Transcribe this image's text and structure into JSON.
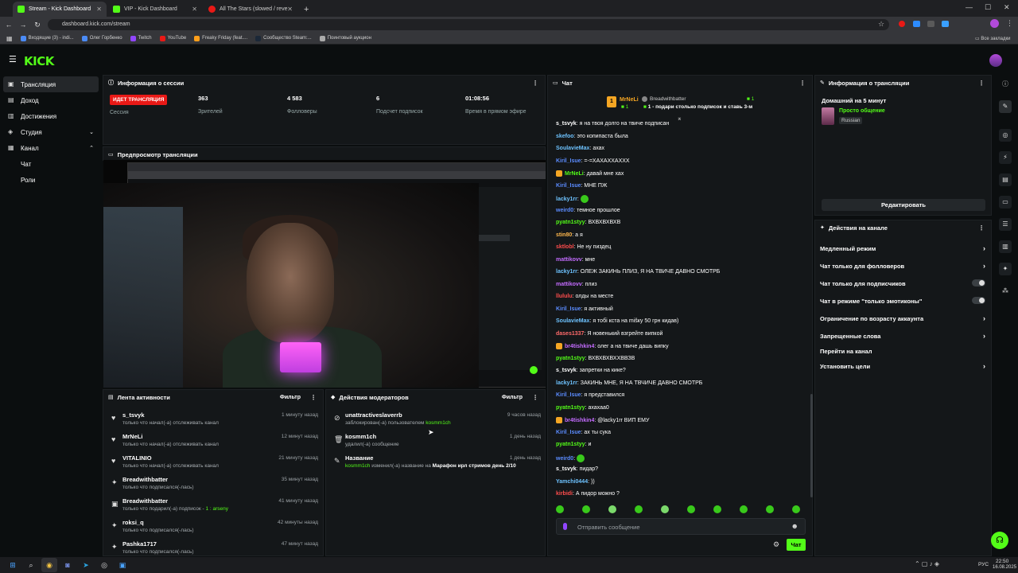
{
  "browser": {
    "tabs": [
      {
        "title": "Stream - Kick Dashboard",
        "active": true,
        "color": "#53fc18"
      },
      {
        "title": "VIP - Kick Dashboard",
        "active": false,
        "color": "#53fc18"
      },
      {
        "title": "All The Stars (slowed / reve",
        "active": false,
        "color": "#e91916"
      }
    ],
    "url": "dashboard.kick.com/stream",
    "bookmarks": [
      "Входящие (3) - indi...",
      "Олег Горбенко",
      "Twitch",
      "YouTube",
      "Freaky Friday (feat....",
      "Сообщество Steam:...",
      "Поинтовый аукцион"
    ],
    "all_bookmarks": "Все закладки"
  },
  "kick": {
    "logo": "KICK",
    "sidebar": [
      {
        "label": "Трансляция",
        "icon": "broadcast-icon",
        "active": true
      },
      {
        "label": "Доход",
        "icon": "wallet-icon"
      },
      {
        "label": "Достижения",
        "icon": "trophy-icon"
      },
      {
        "label": "Студия",
        "icon": "studio-icon",
        "chevron": "down"
      },
      {
        "label": "Канал",
        "icon": "channel-icon",
        "chevron": "up"
      }
    ],
    "sidebar_sub": [
      "Чат",
      "Роли"
    ]
  },
  "session": {
    "title": "Информация о сессии",
    "live_badge": "ИДЕТ ТРАНСЛЯЦИЯ",
    "session_label": "Сессия",
    "stats": [
      {
        "value": "363",
        "label": "Зрителей"
      },
      {
        "value": "4 583",
        "label": "Фолловеры"
      },
      {
        "value": "6",
        "label": "Подсчет подписок"
      },
      {
        "value": "01:08:56",
        "label": "Время в прямом эфире"
      }
    ]
  },
  "preview": {
    "title": "Предпросмотр трансляции"
  },
  "activity": {
    "title": "Лента активности",
    "filter": "Фильтр",
    "items": [
      {
        "name": "s_tsvyk",
        "desc": "только что начал(-а) отслеживать канал",
        "time": "1 минуту назад",
        "icon": "heart-icon"
      },
      {
        "name": "MrNeLi",
        "desc": "только что начал(-а) отслеживать канал",
        "time": "12 минут назад",
        "icon": "heart-icon"
      },
      {
        "name": "VITALINIO",
        "desc": "только что начал(-а) отслеживать канал",
        "time": "21 минуту назад",
        "icon": "heart-icon"
      },
      {
        "name": "Breadwithbatter",
        "desc": "только что подписался(-лась)",
        "time": "35 минут назад",
        "icon": "star-icon"
      },
      {
        "name": "Breadwithbatter",
        "desc": "только что подарил(-а) подписок - ",
        "desc_extra": "1 : arseny",
        "time": "41 минуту назад",
        "icon": "gift-icon"
      },
      {
        "name": "roksi_q",
        "desc": "только что подписался(-лась)",
        "time": "42 минуты назад",
        "icon": "star-icon"
      },
      {
        "name": "Pashka1717",
        "desc": "только что подписался(-лась)",
        "time": "47 минут назад",
        "icon": "star-icon"
      }
    ]
  },
  "moderators": {
    "title": "Действия модераторов",
    "filter": "Фильтр",
    "items": [
      {
        "name": "unattractiveslaverrb",
        "desc": "заблокирован(-а) пользователем ",
        "who": "kosmm1ch",
        "time": "9 часов назад",
        "icon": "ban-icon"
      },
      {
        "name": "kosmm1ch",
        "desc": "удалил(-а) сообщение",
        "time": "1 день назад",
        "icon": "trash-icon"
      },
      {
        "name": "Название",
        "who": "kosmm1ch",
        "desc": " изменил(-а) название на ",
        "extra": "Марафон ирл стримов день 2/10",
        "time": "1 день назад",
        "icon": "edit-icon"
      }
    ]
  },
  "chat": {
    "title": "Чат",
    "pinned_user": "MrNeLi",
    "pinned_count": "1",
    "pinned_by": "Breadwithbatter",
    "pinned_count2": "1",
    "pinned_text": "1 - подари столько подписок и ставь 3-м",
    "messages": [
      {
        "user": "s_tsvyk",
        "color": "#ffffff",
        "text": "я на твоя долго на твиче подписан"
      },
      {
        "user": "skefoo",
        "color": "#6ec3ff",
        "text": "это копипаста была"
      },
      {
        "user": "SoulavieMax",
        "color": "#6ec3ff",
        "text": "ахах"
      },
      {
        "user": "Kiril_Isue",
        "color": "#5b8cff",
        "text": "=-=ХАХАХХАХХХ"
      },
      {
        "user": "MrNeLi",
        "color": "#53fc18",
        "text": "давай мне хах",
        "badge": true
      },
      {
        "user": "Kiril_Isue",
        "color": "#5b8cff",
        "text": "МНЕ ПЖ"
      },
      {
        "user": "lacky1rr",
        "color": "#6ec3ff",
        "text": "",
        "emote": true
      },
      {
        "user": "weird0",
        "color": "#5b8cff",
        "text": "темное прошлое"
      },
      {
        "user": "pyatn1styy",
        "color": "#53fc18",
        "text": "ВХВХВХВХВ"
      },
      {
        "user": "stin80",
        "color": "#ffb84d",
        "text": "а я"
      },
      {
        "user": "sktlobl",
        "color": "#ff4d4d",
        "text": "Не ну пиздец"
      },
      {
        "user": "mattikovv",
        "color": "#c46cff",
        "text": "мне"
      },
      {
        "user": "lacky1rr",
        "color": "#6ec3ff",
        "text": "ОЛЕЖ ЗАКИНЬ ПЛИЗ, Я НА ТВИЧЕ ДАВНО СМОТРБ"
      },
      {
        "user": "mattikovv",
        "color": "#c46cff",
        "text": "плиз"
      },
      {
        "user": "llululu",
        "color": "#ff4d4d",
        "text": "олды на месте"
      },
      {
        "user": "Kiril_Isue",
        "color": "#5b8cff",
        "text": "я активный"
      },
      {
        "user": "SoulavieMax",
        "color": "#6ec3ff",
        "text": "я тобі кста на mišку 50 грн кидав)"
      },
      {
        "user": "dases1337",
        "color": "#ff6b6b",
        "text": "Я новенький взгрейте випкой"
      },
      {
        "user": "br4tishkin4",
        "color": "#c46cff",
        "text": "олег а на твиче дашь випку",
        "badge": true
      },
      {
        "user": "pyatn1styy",
        "color": "#53fc18",
        "text": "ВХВХВХВХХВВЗВ"
      },
      {
        "user": "s_tsvyk",
        "color": "#ffffff",
        "text": "запретки на кике?"
      },
      {
        "user": "lacky1rr",
        "color": "#6ec3ff",
        "text": "ЗАКИНЬ МНЕ, Я НА ТВЧИЧЕ ДАВНО СМОТРБ"
      },
      {
        "user": "Kiril_Isue",
        "color": "#5b8cff",
        "text": "я представился"
      },
      {
        "user": "pyatn1styy",
        "color": "#53fc18",
        "text": "ахахаа0"
      },
      {
        "user": "br4tishkin4",
        "color": "#c46cff",
        "text": "@lacky1rr ВИП ЕМУ",
        "badge": true
      },
      {
        "user": "Kiril_Isue",
        "color": "#5b8cff",
        "text": "ах ты сука"
      },
      {
        "user": "pyatn1styy",
        "color": "#53fc18",
        "text": "и"
      },
      {
        "user": "weird0",
        "color": "#5b8cff",
        "text": "",
        "emote": true
      },
      {
        "user": "s_tsvyk",
        "color": "#ffffff",
        "text": "пидар?"
      },
      {
        "user": "Yamchi0444",
        "color": "#6ec3ff",
        "text": "))"
      },
      {
        "user": "kirbidi",
        "color": "#ff4d4d",
        "text": "А пидор можно ?"
      }
    ],
    "input_placeholder": "Отправить сообщение",
    "send_label": "Чат"
  },
  "stream_info": {
    "title": "Информация о трансляции",
    "stream_title": "Домашний на 5 минут",
    "category": "Просто общение",
    "language": "Russian",
    "edit_label": "Редактировать"
  },
  "channel_actions": {
    "title": "Действия на канале",
    "items": [
      {
        "label": "Медленный режим",
        "control": "chevron"
      },
      {
        "label": "Чат только для фолловеров",
        "control": "chevron"
      },
      {
        "label": "Чат только для подписчиков",
        "control": "toggle"
      },
      {
        "label": "Чат в режиме \"только эмотиконы\"",
        "control": "toggle"
      },
      {
        "label": "Ограничение по возрасту аккаунта",
        "control": "chevron"
      },
      {
        "label": "Запрещенные слова",
        "control": "chevron"
      },
      {
        "label": "Перейти на канал",
        "control": "none"
      },
      {
        "label": "Установить цели",
        "control": "chevron"
      }
    ]
  },
  "taskbar": {
    "lang": "РУС",
    "time": "22:50",
    "date": "16.08.2025"
  },
  "colors": {
    "accent": "#53fc18",
    "live": "#e91916",
    "bg": "#0b0e0f",
    "panel": "#141719"
  }
}
